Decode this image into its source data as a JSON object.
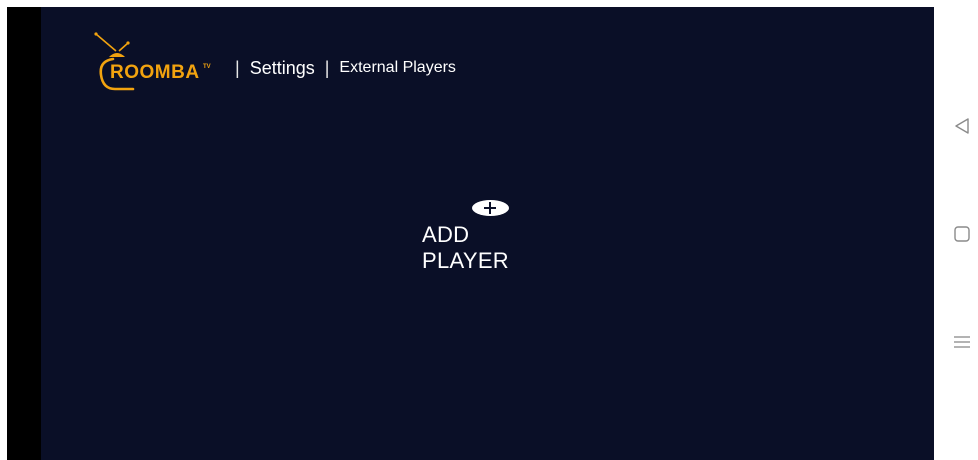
{
  "app": {
    "logo_text": "ROOMBA",
    "logo_superscript": "TV",
    "brand_color": "#f2a30f",
    "background_color": "#0a0f27"
  },
  "breadcrumb": {
    "separator": "|",
    "items": [
      "Settings",
      "External Players"
    ]
  },
  "main": {
    "add_icon": "plus-icon",
    "add_label": "ADD PLAYER"
  },
  "navigation_bar": {
    "buttons": [
      "back-icon",
      "home-icon",
      "menu-icon"
    ]
  }
}
